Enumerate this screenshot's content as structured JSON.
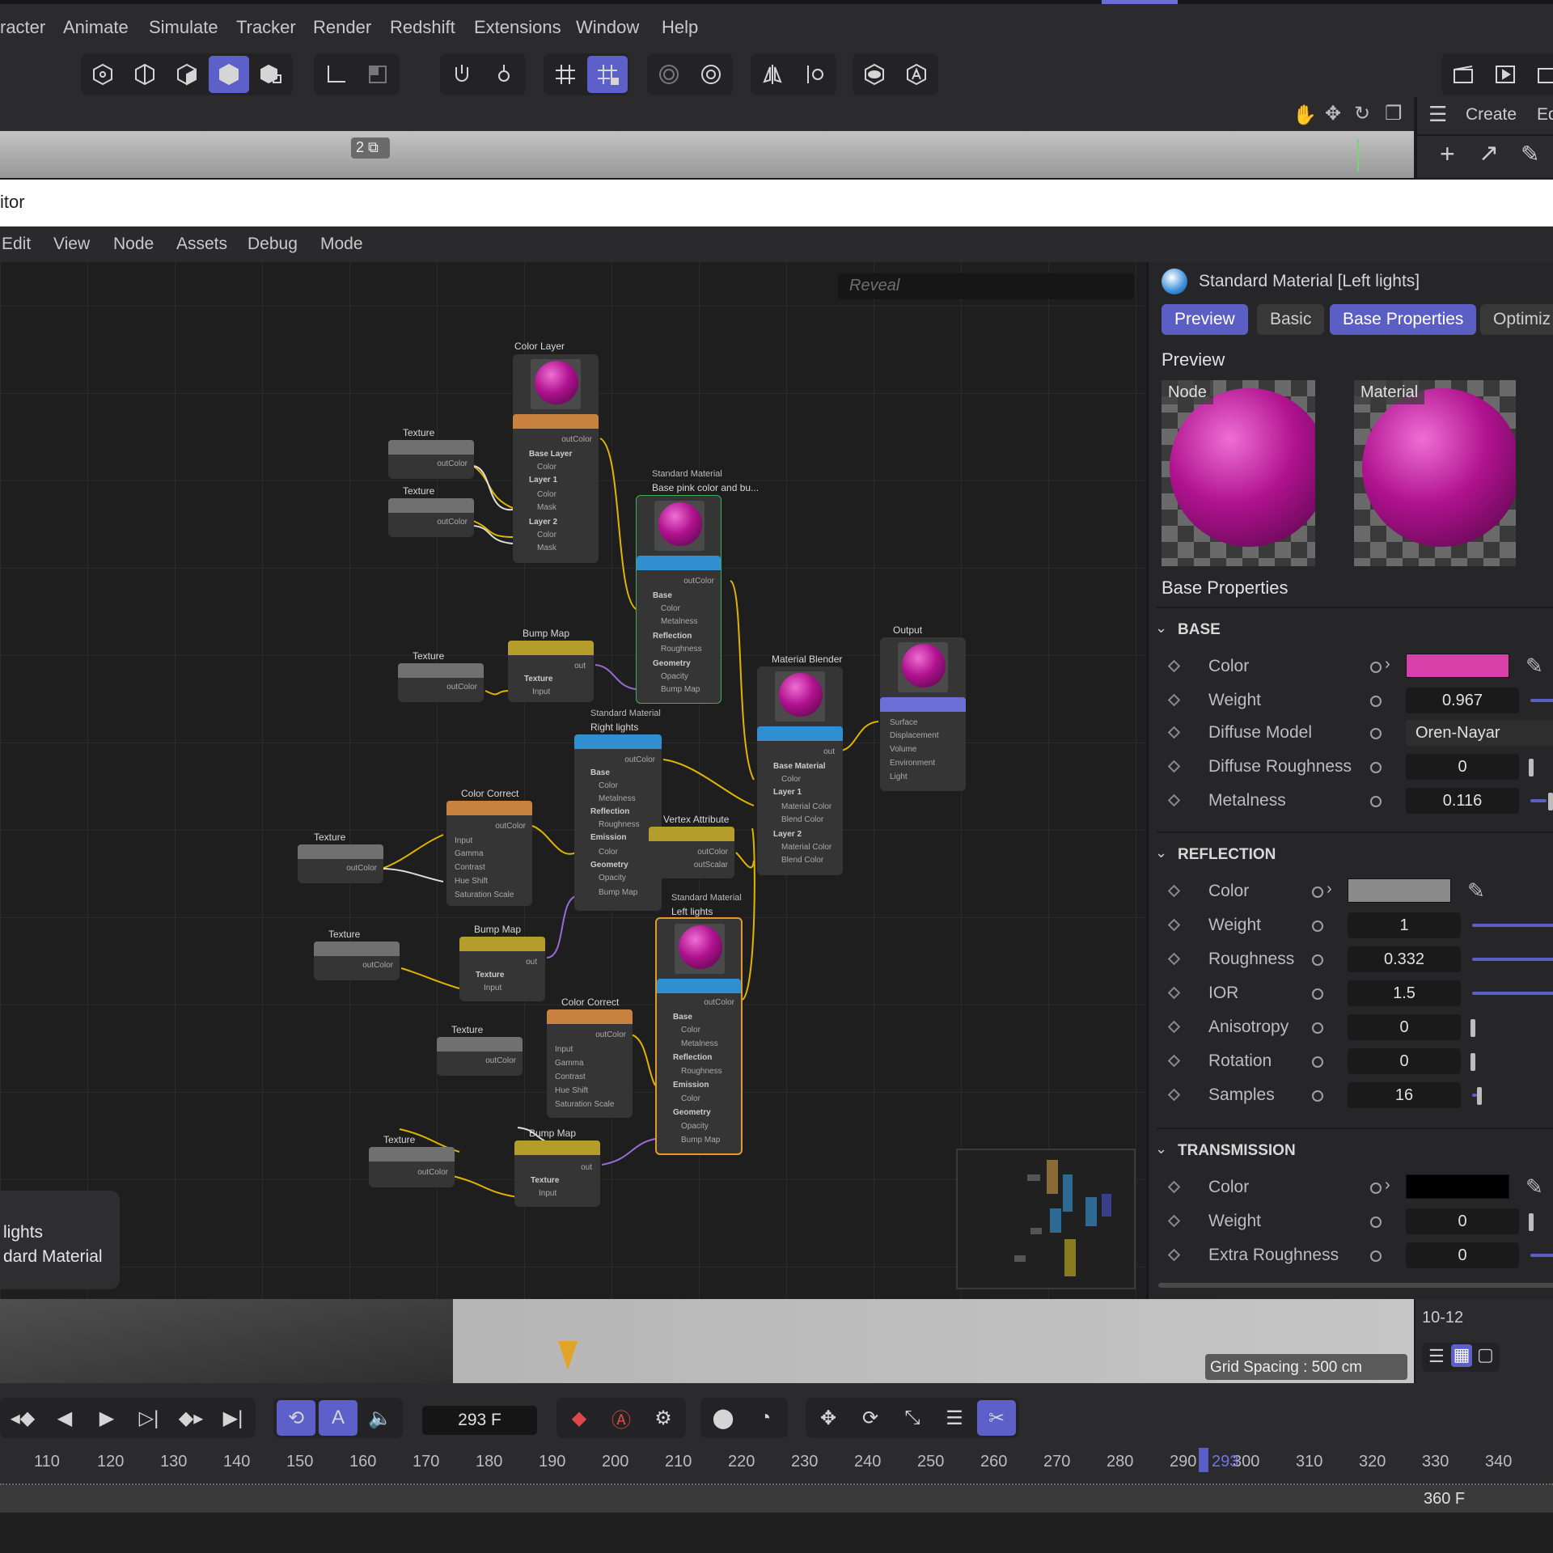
{
  "menu": {
    "items": [
      "racter",
      "Animate",
      "Simulate",
      "Tracker",
      "Render",
      "Redshift",
      "Extensions",
      "Window",
      "Help"
    ]
  },
  "viewport": {
    "badge": "2",
    "right_create": "Create",
    "right_ed": "Ed"
  },
  "editor": {
    "title": "itor",
    "menu": [
      "Edit",
      "View",
      "Node",
      "Assets",
      "Debug",
      "Mode"
    ],
    "reveal_placeholder": "Reveal",
    "tooltip": {
      "line1": "lights",
      "line2": "dard Material"
    }
  },
  "nodes": {
    "color_layer": {
      "title": "Color Layer",
      "out": "outColor",
      "rows": [
        "Base Layer",
        "Color",
        "Layer 1",
        "Color",
        "Mask",
        "Layer 2",
        "Color",
        "Mask"
      ]
    },
    "tex1": {
      "title": "Texture",
      "out": "outColor"
    },
    "tex2": {
      "title": "Texture",
      "out": "outColor"
    },
    "std_base": {
      "title": "Standard Material",
      "subtitle": "Base pink color and bu...",
      "out": "outColor",
      "rows": [
        "Base",
        "Color",
        "Metalness",
        "Reflection",
        "Roughness",
        "Geometry",
        "Opacity",
        "Bump Map"
      ]
    },
    "bump1": {
      "title": "Bump Map",
      "out": "out",
      "rows": [
        "Texture",
        "Input"
      ]
    },
    "tex3": {
      "title": "Texture",
      "out": "outColor"
    },
    "output": {
      "title": "Output",
      "rows": [
        "Surface",
        "Displacement",
        "Volume",
        "Environment",
        "Light"
      ]
    },
    "blender": {
      "title": "Material Blender",
      "out": "out",
      "rows": [
        "Base Material",
        "Color",
        "Layer 1",
        "Material Color",
        "Blend Color",
        "Layer 2",
        "Material Color",
        "Blend Color"
      ]
    },
    "std_right": {
      "title": "Standard Material",
      "subtitle": "Right lights",
      "out": "outColor",
      "rows": [
        "Base",
        "Color",
        "Metalness",
        "Reflection",
        "Roughness",
        "Emission",
        "Color",
        "Geometry",
        "Opacity",
        "Bump Map"
      ]
    },
    "cc1": {
      "title": "Color Correct",
      "out": "outColor",
      "rows": [
        "Input",
        "Gamma",
        "Contrast",
        "Hue Shift",
        "Saturation Scale"
      ]
    },
    "vertex": {
      "title": "Vertex Attribute",
      "out1": "outColor",
      "out2": "outScalar"
    },
    "tex4": {
      "title": "Texture",
      "out": "outColor"
    },
    "tex5": {
      "title": "Texture",
      "out": "outColor"
    },
    "bump2": {
      "title": "Bump Map",
      "out": "out",
      "rows": [
        "Texture",
        "Input"
      ]
    },
    "std_left": {
      "title": "Standard Material",
      "subtitle": "Left lights",
      "out": "outColor",
      "rows": [
        "Base",
        "Color",
        "Metalness",
        "Reflection",
        "Roughness",
        "Emission",
        "Color",
        "Geometry",
        "Opacity",
        "Bump Map"
      ]
    },
    "cc2": {
      "title": "Color Correct",
      "out": "outColor",
      "rows": [
        "Input",
        "Gamma",
        "Contrast",
        "Hue Shift",
        "Saturation Scale"
      ]
    },
    "tex6": {
      "title": "Texture",
      "out": "outColor"
    },
    "tex7": {
      "title": "Texture",
      "out": "outColor"
    },
    "bump3": {
      "title": "Bump Map",
      "out": "out",
      "rows": [
        "Texture",
        "Input"
      ]
    }
  },
  "attributes": {
    "header": "Standard Material [Left lights]",
    "tabs": [
      "Preview",
      "Basic",
      "Base Properties",
      "Optimiz"
    ],
    "preview_title": "Preview",
    "preview_labels": [
      "Node",
      "Material"
    ],
    "section_title": "Base Properties",
    "base": {
      "title": "BASE",
      "color_label": "Color",
      "color_value": "#d83fa8",
      "weight_label": "Weight",
      "weight": "0.967",
      "diffuse_model_label": "Diffuse Model",
      "diffuse_model": "Oren-Nayar",
      "diffuse_roughness_label": "Diffuse Roughness",
      "diffuse_roughness": "0",
      "metalness_label": "Metalness",
      "metalness": "0.116"
    },
    "reflection": {
      "title": "REFLECTION",
      "color_label": "Color",
      "color_value": "#8a8a8a",
      "weight_label": "Weight",
      "weight": "1",
      "roughness_label": "Roughness",
      "roughness": "0.332",
      "ior_label": "IOR",
      "ior": "1.5",
      "anisotropy_label": "Anisotropy",
      "anisotropy": "0",
      "rotation_label": "Rotation",
      "rotation": "0",
      "samples_label": "Samples",
      "samples": "16"
    },
    "transmission": {
      "title": "TRANSMISSION",
      "color_label": "Color",
      "color_value": "#000000",
      "weight_label": "Weight",
      "weight": "0",
      "extra_roughness_label": "Extra Roughness",
      "extra_roughness": "0"
    }
  },
  "timeline": {
    "grid_spacing": "Grid Spacing : 500 cm",
    "right_label": "10-12",
    "current_frame": "293 F",
    "cursor_label": "293",
    "end_frame": "360 F",
    "ticks": [
      "110",
      "120",
      "130",
      "140",
      "150",
      "160",
      "170",
      "180",
      "190",
      "200",
      "210",
      "220",
      "230",
      "240",
      "250",
      "260",
      "270",
      "280",
      "290",
      "300",
      "310",
      "320",
      "330",
      "340"
    ]
  },
  "colors": {
    "accent": "#5b5fc5",
    "material_pink": "#d83fa8",
    "wire": "#e0b400",
    "wire_purple": "#9a6ad6"
  }
}
